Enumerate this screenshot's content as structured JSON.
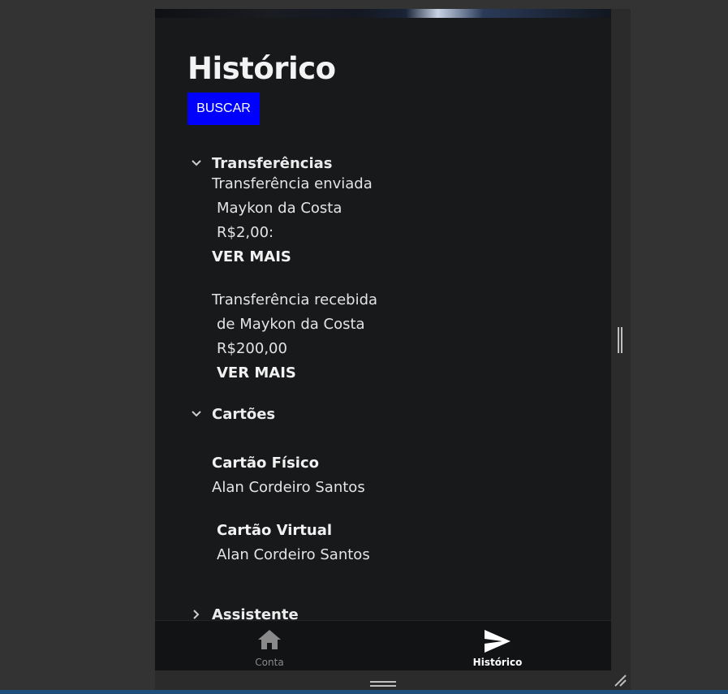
{
  "page": {
    "title": "Histórico",
    "search_button": "BUSCAR"
  },
  "sections": {
    "transfers": {
      "label": "Transferências",
      "items": [
        {
          "line1": "Transferência enviada",
          "line2": "Maykon da Costa",
          "line3": "R$2,00:",
          "action": "VER MAIS"
        },
        {
          "line1": "Transferência recebida",
          "line2": "de Maykon da Costa",
          "line3": "R$200,00",
          "action": "VER MAIS"
        }
      ]
    },
    "cards": {
      "label": "Cartões",
      "items": [
        {
          "type": "Cartão Físico",
          "holder": "Alan Cordeiro Santos"
        },
        {
          "type": "Cartão Virtual",
          "holder": "Alan Cordeiro Santos"
        }
      ]
    },
    "assistant": {
      "label": "Assistente"
    }
  },
  "bottom_nav": {
    "items": [
      {
        "label": "Conta",
        "icon": "home-icon",
        "active": false
      },
      {
        "label": "Histórico",
        "icon": "send-icon",
        "active": true
      }
    ]
  },
  "colors": {
    "background": "#18191b",
    "accent_button": "#0000ff",
    "nav_active": "#ffffff",
    "nav_inactive": "#8a8a8a"
  }
}
